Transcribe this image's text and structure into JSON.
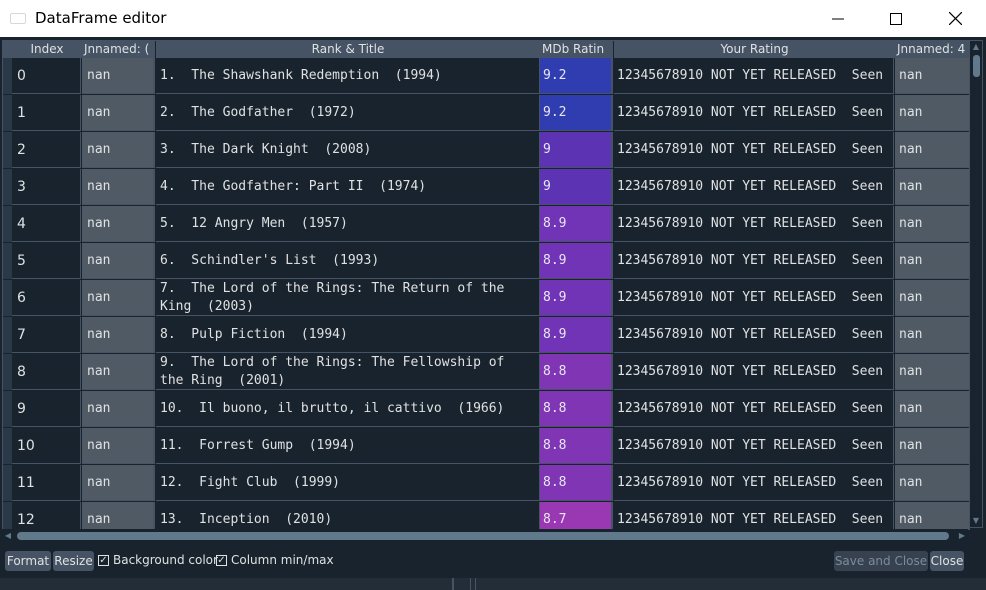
{
  "window": {
    "title": "DataFrame editor",
    "minimize_icon": "minimize-icon",
    "maximize_icon": "maximize-icon",
    "close_icon": "close-icon"
  },
  "columns": {
    "index": "Index",
    "unnamed0": "Jnnamed: (",
    "rank_title": "Rank & Title",
    "imdb": "MDb Ratin",
    "your_rating": "Your Rating",
    "unnamed4": "Jnnamed: 4"
  },
  "rows": [
    {
      "index": "0",
      "un0": "nan",
      "title": "1.  The Shawshank Redemption  (1994)",
      "rating": "9.2",
      "your": "12345678910 NOT YET RELEASED  Seen",
      "un4": "nan",
      "color": "#2f3db0"
    },
    {
      "index": "1",
      "un0": "nan",
      "title": "2.  The Godfather  (1972)",
      "rating": "9.2",
      "your": "12345678910 NOT YET RELEASED  Seen",
      "un4": "nan",
      "color": "#2f3db0"
    },
    {
      "index": "2",
      "un0": "nan",
      "title": "3.  The Dark Knight  (2008)",
      "rating": "9",
      "your": "12345678910 NOT YET RELEASED  Seen",
      "un4": "nan",
      "color": "#5b33b3"
    },
    {
      "index": "3",
      "un0": "nan",
      "title": "4.  The Godfather: Part II  (1974)",
      "rating": "9",
      "your": "12345678910 NOT YET RELEASED  Seen",
      "un4": "nan",
      "color": "#5b33b3"
    },
    {
      "index": "4",
      "un0": "nan",
      "title": "5.  12 Angry Men  (1957)",
      "rating": "8.9",
      "your": "12345678910 NOT YET RELEASED  Seen",
      "un4": "nan",
      "color": "#7234b6"
    },
    {
      "index": "5",
      "un0": "nan",
      "title": "6.  Schindler's List  (1993)",
      "rating": "8.9",
      "your": "12345678910 NOT YET RELEASED  Seen",
      "un4": "nan",
      "color": "#7234b6"
    },
    {
      "index": "6",
      "un0": "nan",
      "title": "7.  The Lord of the Rings: The Return of the\nKing  (2003)",
      "rating": "8.9",
      "your": "12345678910 NOT YET RELEASED  Seen",
      "un4": "nan",
      "color": "#7234b6"
    },
    {
      "index": "7",
      "un0": "nan",
      "title": "8.  Pulp Fiction  (1994)",
      "rating": "8.9",
      "your": "12345678910 NOT YET RELEASED  Seen",
      "un4": "nan",
      "color": "#7234b6"
    },
    {
      "index": "8",
      "un0": "nan",
      "title": "9.  The Lord of the Rings: The Fellowship of\nthe Ring  (2001)",
      "rating": "8.8",
      "your": "12345678910 NOT YET RELEASED  Seen",
      "un4": "nan",
      "color": "#8035b5"
    },
    {
      "index": "9",
      "un0": "nan",
      "title": "10.  Il buono, il brutto, il cattivo  (1966)",
      "rating": "8.8",
      "your": "12345678910 NOT YET RELEASED  Seen",
      "un4": "nan",
      "color": "#8035b5"
    },
    {
      "index": "10",
      "un0": "nan",
      "title": "11.  Forrest Gump  (1994)",
      "rating": "8.8",
      "your": "12345678910 NOT YET RELEASED  Seen",
      "un4": "nan",
      "color": "#8035b5"
    },
    {
      "index": "11",
      "un0": "nan",
      "title": "12.  Fight Club  (1999)",
      "rating": "8.8",
      "your": "12345678910 NOT YET RELEASED  Seen",
      "un4": "nan",
      "color": "#8035b5"
    },
    {
      "index": "12",
      "un0": "nan",
      "title": "13.  Inception  (2010)",
      "rating": "8.7",
      "your": "12345678910 NOT YET RELEASED  Seen",
      "un4": "nan",
      "color": "#9a38b3"
    }
  ],
  "toolbar": {
    "format": "Format",
    "resize": "Resize",
    "background_color": "Background color",
    "background_color_checked": true,
    "column_minmax": "Column min/max",
    "column_minmax_checked": true,
    "save_and_close": "Save and Close",
    "close": "Close"
  }
}
